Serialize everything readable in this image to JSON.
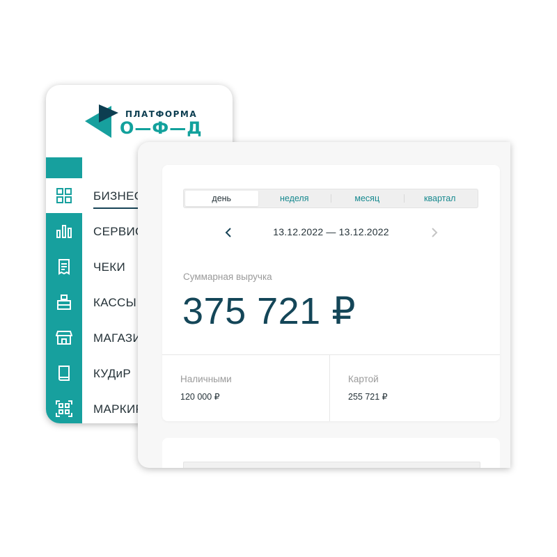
{
  "logo": {
    "top_text": "ПЛАТФОРМА",
    "bottom_text": "О—Ф—Д"
  },
  "colors": {
    "accent": "#17a09e",
    "dark": "#144658",
    "muted": "#9a9a9a"
  },
  "sidebar": {
    "items": [
      {
        "icon": "dashboard-grid-icon",
        "label": "БИЗНЕС"
      },
      {
        "icon": "bar-chart-icon",
        "label": "СЕРВИС"
      },
      {
        "icon": "receipt-icon",
        "label": "ЧЕКИ"
      },
      {
        "icon": "cash-register-icon",
        "label": "КАССЫ"
      },
      {
        "icon": "store-icon",
        "label": "МАГАЗИ"
      },
      {
        "icon": "book-icon",
        "label": "КУДиР"
      },
      {
        "icon": "qr-code-icon",
        "label": "МАРКИР"
      }
    ]
  },
  "period_tabs": [
    "день",
    "неделя",
    "месяц",
    "квартал"
  ],
  "active_tab": "день",
  "date_range": "13.12.2022 — 13.12.2022",
  "revenue": {
    "label": "Суммарная выручка",
    "value": "375 721 ₽",
    "cash_label": "Наличными",
    "cash_value": "120 000 ₽",
    "card_label": "Картой",
    "card_value": "255 721 ₽"
  }
}
